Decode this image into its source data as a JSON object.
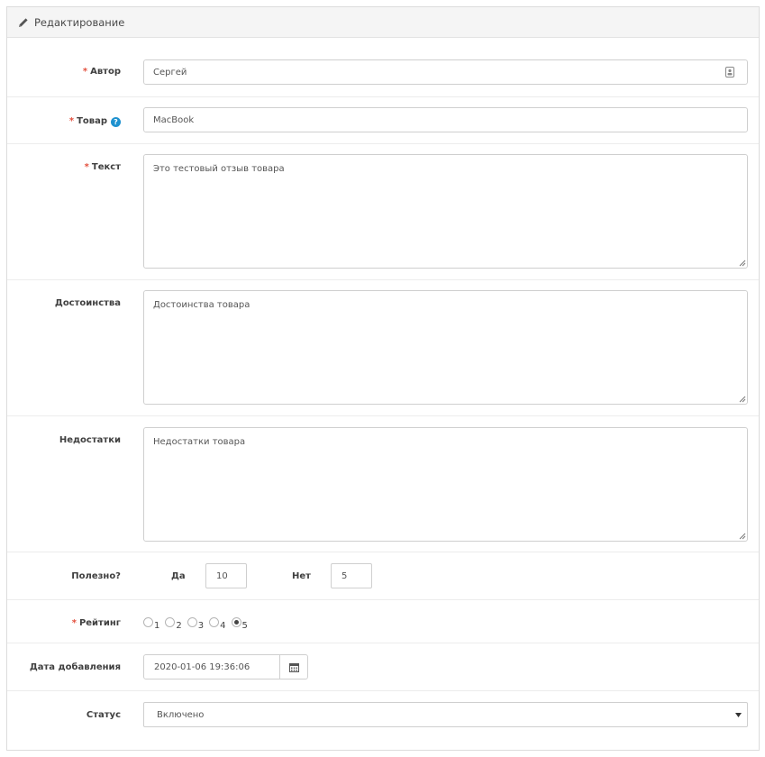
{
  "panel": {
    "title": "Редактирование",
    "icon": "pencil-icon"
  },
  "form": {
    "author": {
      "label": "Автор",
      "required": "*",
      "value": "Сергей",
      "icon": "contact-card-icon"
    },
    "product": {
      "label": "Товар",
      "required": "*",
      "help": "?",
      "value": "MacBook"
    },
    "text": {
      "label": "Текст",
      "required": "*",
      "value": "Это тестовый отзыв товара"
    },
    "pros": {
      "label": "Достоинства",
      "value": "Достоинства товара"
    },
    "cons": {
      "label": "Недостатки",
      "value": "Недостатки товара"
    },
    "helpful": {
      "label": "Полезно?",
      "yes_label": "Да",
      "yes_value": "10",
      "no_label": "Нет",
      "no_value": "5"
    },
    "rating": {
      "label": "Рейтинг",
      "required": "*",
      "options": [
        "1",
        "2",
        "3",
        "4",
        "5"
      ],
      "selected": "5"
    },
    "date_added": {
      "label": "Дата добавления",
      "value": "2020-01-06 19:36:06",
      "icon": "calendar-icon"
    },
    "status": {
      "label": "Статус",
      "value": "Включено",
      "icon": "caret-down-icon"
    }
  },
  "colors": {
    "required": "#e3503e",
    "help": "#1e91cf",
    "border": "#cfcfcf"
  }
}
